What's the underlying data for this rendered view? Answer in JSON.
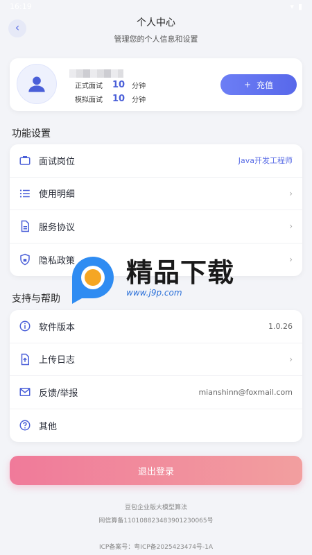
{
  "status_bar": {
    "time": "16:19"
  },
  "header": {
    "title": "个人中心",
    "subtitle": "管理您的个人信息和设置"
  },
  "profile": {
    "formal_label": "正式面试",
    "formal_value": "10",
    "formal_unit": "分钟",
    "mock_label": "模拟面试",
    "mock_value": "10",
    "mock_unit": "分钟",
    "recharge_label": "充值"
  },
  "sections": {
    "settings_title": "功能设置",
    "support_title": "支持与帮助"
  },
  "settings_items": [
    {
      "label": "面试岗位",
      "value": "Java开发工程师"
    },
    {
      "label": "使用明细"
    },
    {
      "label": "服务协议"
    },
    {
      "label": "隐私政策"
    }
  ],
  "support_items": [
    {
      "label": "软件版本",
      "value": "1.0.26"
    },
    {
      "label": "上传日志"
    },
    {
      "label": "反馈/举报",
      "value": "mianshinn@foxmail.com"
    },
    {
      "label": "其他"
    }
  ],
  "logout_label": "退出登录",
  "footer": {
    "line1": "豆包企业版大模型算法",
    "line2": "网信算备110108823483901230065号",
    "line3": "ICP备案号：粤ICP备2025423474号-1A"
  },
  "watermark": {
    "main": "精品下载",
    "url": "www.j9p.com"
  },
  "colors": {
    "accent": "#5b6ee6",
    "logout_start": "#f07a9a",
    "logout_end": "#f29f9f"
  }
}
